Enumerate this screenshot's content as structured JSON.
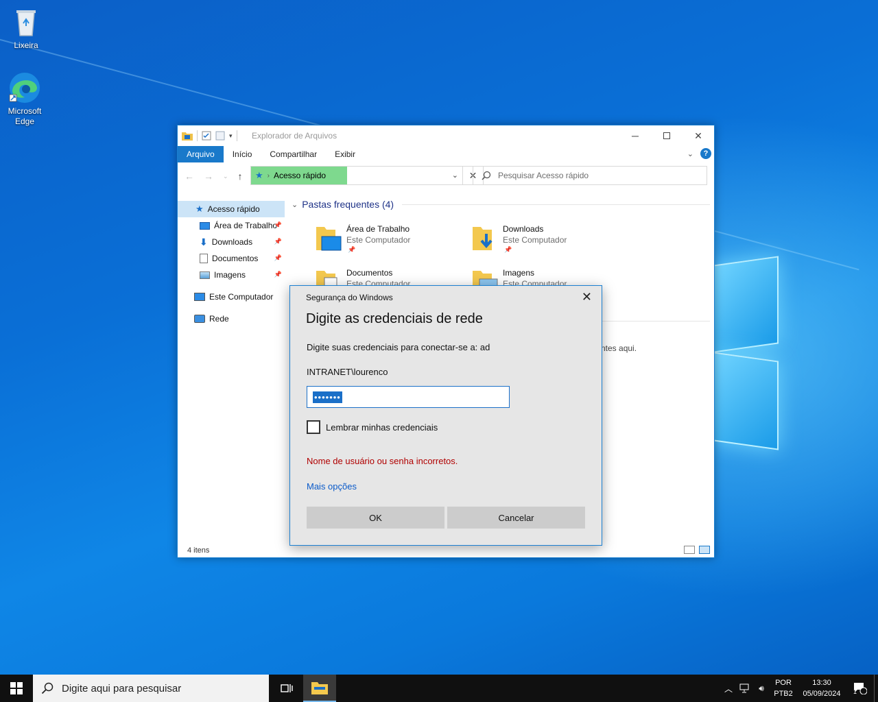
{
  "desktop": {
    "icons": [
      {
        "label": "Lixeira",
        "icon": "recycle-bin-icon"
      },
      {
        "label": "Microsoft\nEdge",
        "icon": "edge-icon"
      }
    ]
  },
  "explorer": {
    "title": "Explorador de Arquivos",
    "ribbon_tabs": [
      "Arquivo",
      "Início",
      "Compartilhar",
      "Exibir"
    ],
    "address": "Acesso rápido",
    "search_placeholder": "Pesquisar Acesso rápido",
    "sidebar": [
      {
        "label": "Acesso rápido",
        "pinned": false,
        "active": true
      },
      {
        "label": "Área de Trabalho",
        "pinned": true
      },
      {
        "label": "Downloads",
        "pinned": true
      },
      {
        "label": "Documentos",
        "pinned": true
      },
      {
        "label": "Imagens",
        "pinned": true
      },
      {
        "label": "Este Computador",
        "pinned": false
      },
      {
        "label": "Rede",
        "pinned": false
      }
    ],
    "section_title": "Pastas frequentes (4)",
    "folders": [
      {
        "name": "Área de Trabalho",
        "location": "Este Computador"
      },
      {
        "name": "Downloads",
        "location": "Este Computador"
      },
      {
        "name": "Documentos",
        "location": "Este Computador"
      },
      {
        "name": "Imagens",
        "location": "Este Computador"
      }
    ],
    "recent_partial_text": "ntes aqui.",
    "status": "4 itens"
  },
  "dialog": {
    "caption": "Segurança do Windows",
    "title": "Digite as credenciais de rede",
    "prompt": "Digite suas credenciais para conectar-se a: ad",
    "username": "INTRANET\\lourenco",
    "password_mask": "•••••••",
    "remember_label": "Lembrar minhas credenciais",
    "remember_checked": false,
    "error": "Nome de usuário ou senha incorretos.",
    "more_options": "Mais opções",
    "ok_label": "OK",
    "cancel_label": "Cancelar"
  },
  "taskbar": {
    "search_placeholder": "Digite aqui para pesquisar",
    "language_line1": "POR",
    "language_line2": "PTB2",
    "time": "13:30",
    "date": "05/09/2024",
    "notification_count": "1"
  },
  "colors": {
    "accent": "#1979ca",
    "error": "#b00000",
    "link": "#0a5ac9",
    "address_highlight": "#7ed98e"
  }
}
